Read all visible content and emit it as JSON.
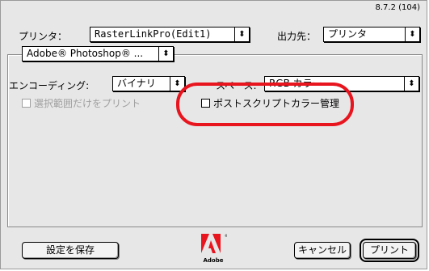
{
  "version": "8.7.2 (104)",
  "printer": {
    "label": "プリンタ：",
    "value": "RasterLinkPro(Edit1)"
  },
  "destination": {
    "label": "出力先：",
    "value": "プリンタ"
  },
  "plugin_menu": {
    "value": "Adobe® Photoshop® ..."
  },
  "encoding": {
    "label": "エンコーディング:",
    "value": "バイナリ"
  },
  "space": {
    "label": "スペース:",
    "value": "RGB カラー"
  },
  "print_selection": {
    "label": "選択範囲だけをプリント",
    "checked": false,
    "enabled": false
  },
  "postscript_color": {
    "label": "ポストスクリプトカラー管理",
    "checked": false
  },
  "buttons": {
    "save_settings": "設定を保存",
    "cancel": "キャンセル",
    "print": "プリント"
  },
  "logo": {
    "wordmark": "Adobe",
    "icon": "adobe-logo-icon"
  },
  "arrow_glyph": "⬍",
  "colors": {
    "highlight": "#e8141e",
    "dialog_bg": "#e7e7e7"
  }
}
